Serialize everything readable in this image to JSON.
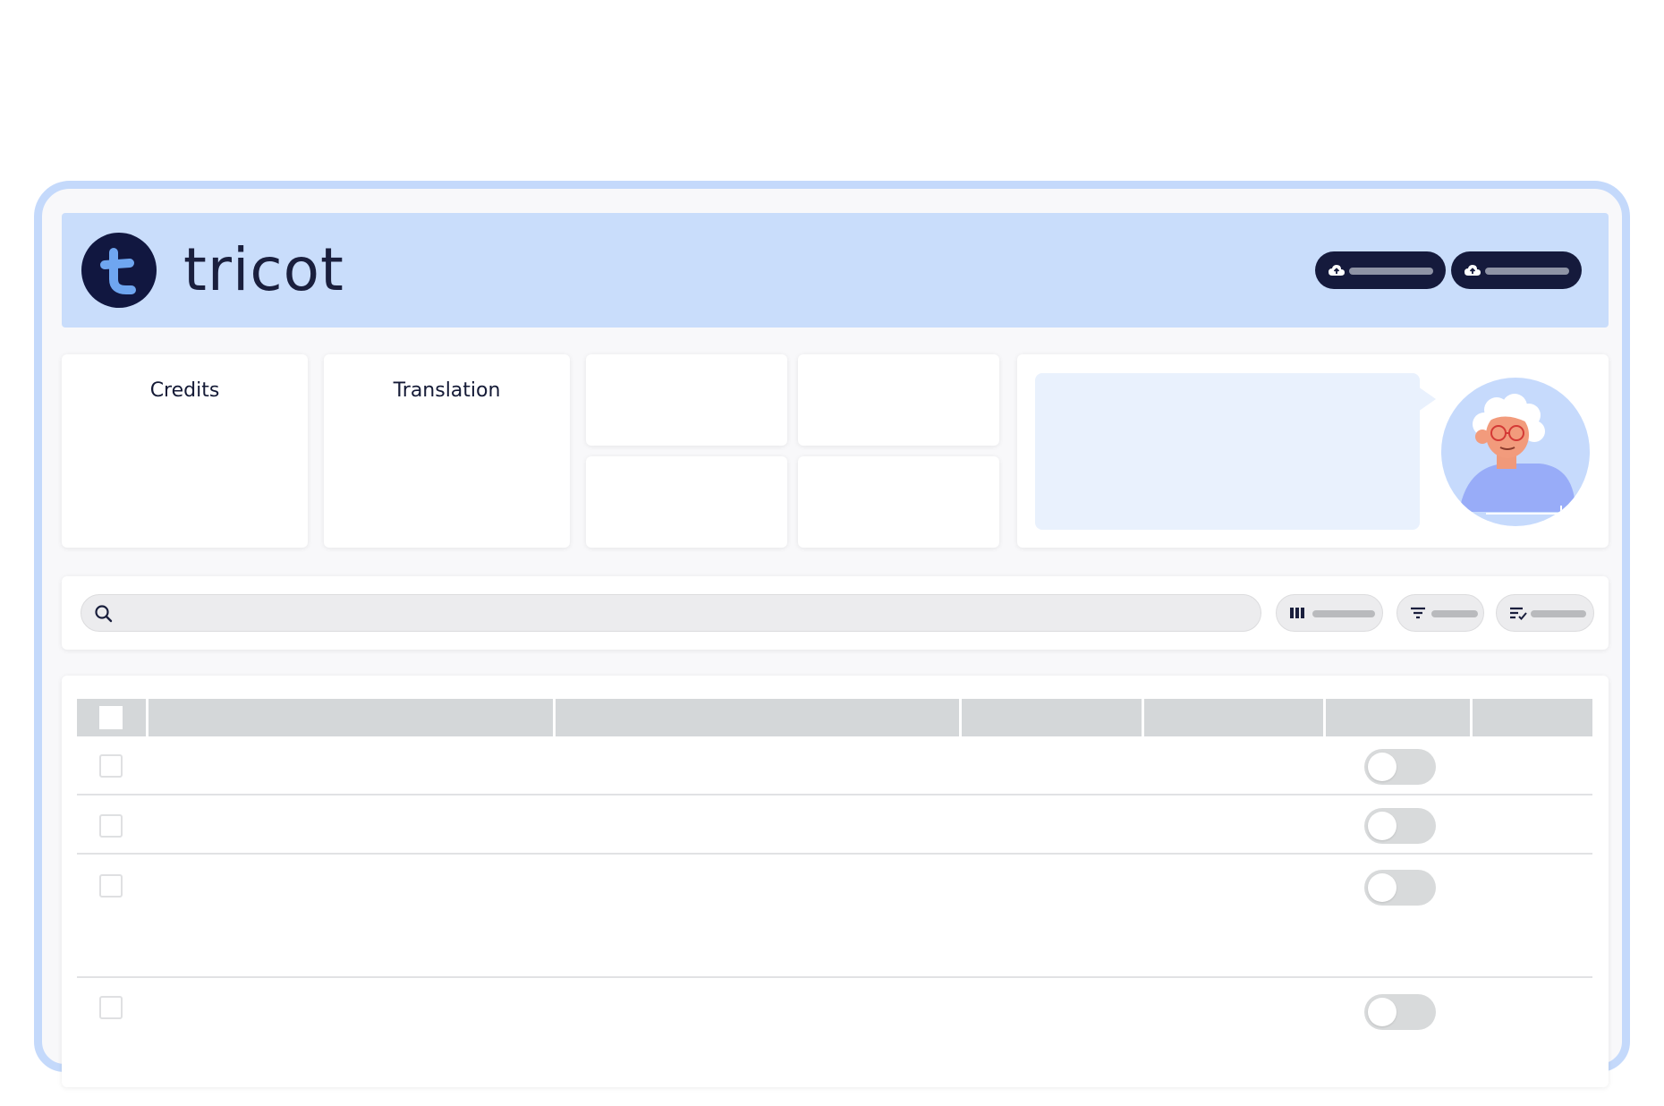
{
  "brand": {
    "name": "tricot",
    "logo_letter": "t",
    "colors": {
      "navy": "#111740",
      "light_blue": "#c9ddfb",
      "accent_blue": "#6fa6f0"
    }
  },
  "header": {
    "buttons": [
      {
        "icon": "cloud-upload-icon"
      },
      {
        "icon": "cloud-upload-icon"
      }
    ]
  },
  "cards": {
    "credits_title": "Credits",
    "translation_title": "Translation"
  },
  "toolbar": {
    "search": {
      "icon": "search-icon",
      "placeholder": ""
    },
    "pills": [
      {
        "icon": "columns-icon"
      },
      {
        "icon": "filter-icon"
      },
      {
        "icon": "sort-icon"
      }
    ]
  },
  "table": {
    "rows": [
      {
        "toggle_on": false
      },
      {
        "toggle_on": false
      },
      {
        "toggle_on": false
      },
      {
        "toggle_on": false
      }
    ]
  }
}
